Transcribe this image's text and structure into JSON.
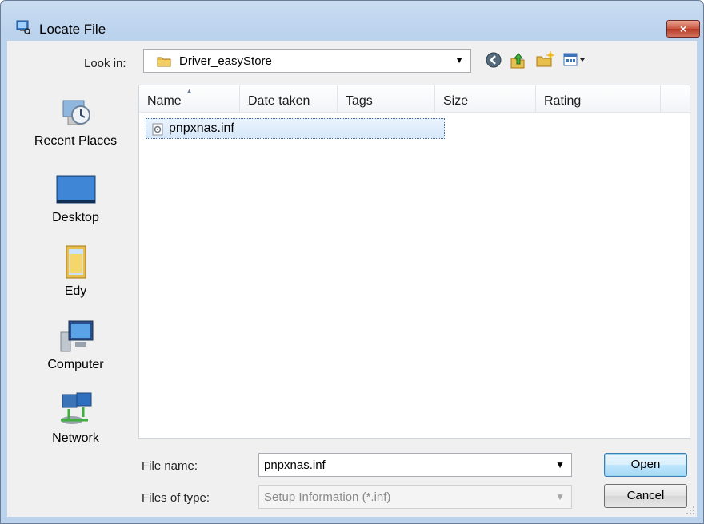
{
  "window": {
    "title": "Locate File",
    "close_label": "×"
  },
  "toolbar": {
    "look_in_label": "Look in:",
    "look_in_value": "Driver_easyStore",
    "icons": [
      "back-icon",
      "up-folder-icon",
      "new-folder-icon",
      "views-menu-icon"
    ]
  },
  "places": [
    {
      "label": "Recent Places",
      "icon": "recent-places-icon"
    },
    {
      "label": "Desktop",
      "icon": "desktop-icon"
    },
    {
      "label": "Edy",
      "icon": "user-folder-icon"
    },
    {
      "label": "Computer",
      "icon": "computer-icon"
    },
    {
      "label": "Network",
      "icon": "network-icon"
    }
  ],
  "file_list": {
    "columns": [
      "Name",
      "Date taken",
      "Tags",
      "Size",
      "Rating"
    ],
    "sorted_by": "Name",
    "files": [
      {
        "name": "pnpxnas.inf",
        "icon": "inf-file-icon",
        "selected": true
      }
    ]
  },
  "form": {
    "file_name_label": "File name:",
    "file_name_value": "pnpxnas.inf",
    "file_type_label": "Files of type:",
    "file_type_value": "Setup Information (*.inf)"
  },
  "buttons": {
    "open": "Open",
    "cancel": "Cancel"
  },
  "colors": {
    "title_bar": "#bcd3ee",
    "close_button": "#c9553f",
    "selection": "#d6e8fa",
    "default_button": "#a7d9f5"
  }
}
